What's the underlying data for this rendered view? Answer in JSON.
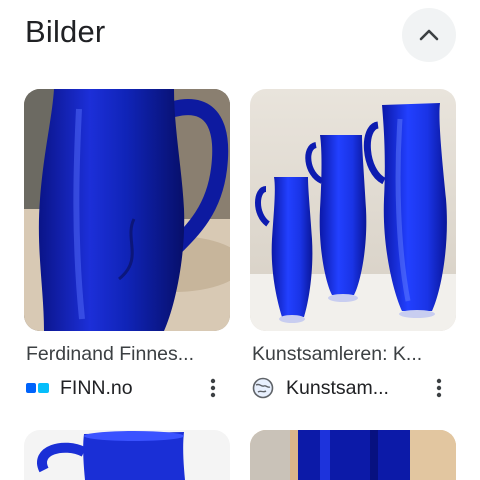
{
  "section": {
    "title": "Bilder",
    "collapse_icon": "chevron-up-icon"
  },
  "results": [
    {
      "caption": "Ferdinand Finnes...",
      "source": "FINN.no",
      "source_icon": "finn-logo-icon",
      "more_icon": "more-vert-icon"
    },
    {
      "caption": "Kunstsamleren: K...",
      "source": "Kunstsam...",
      "source_icon": "globe-icon",
      "more_icon": "more-vert-icon"
    }
  ],
  "colors": {
    "cobalt": "#1a2fd6",
    "cobalt_dark": "#0a1488",
    "finn_blue": "#0063fb",
    "collapse_bg": "#f1f3f4"
  }
}
